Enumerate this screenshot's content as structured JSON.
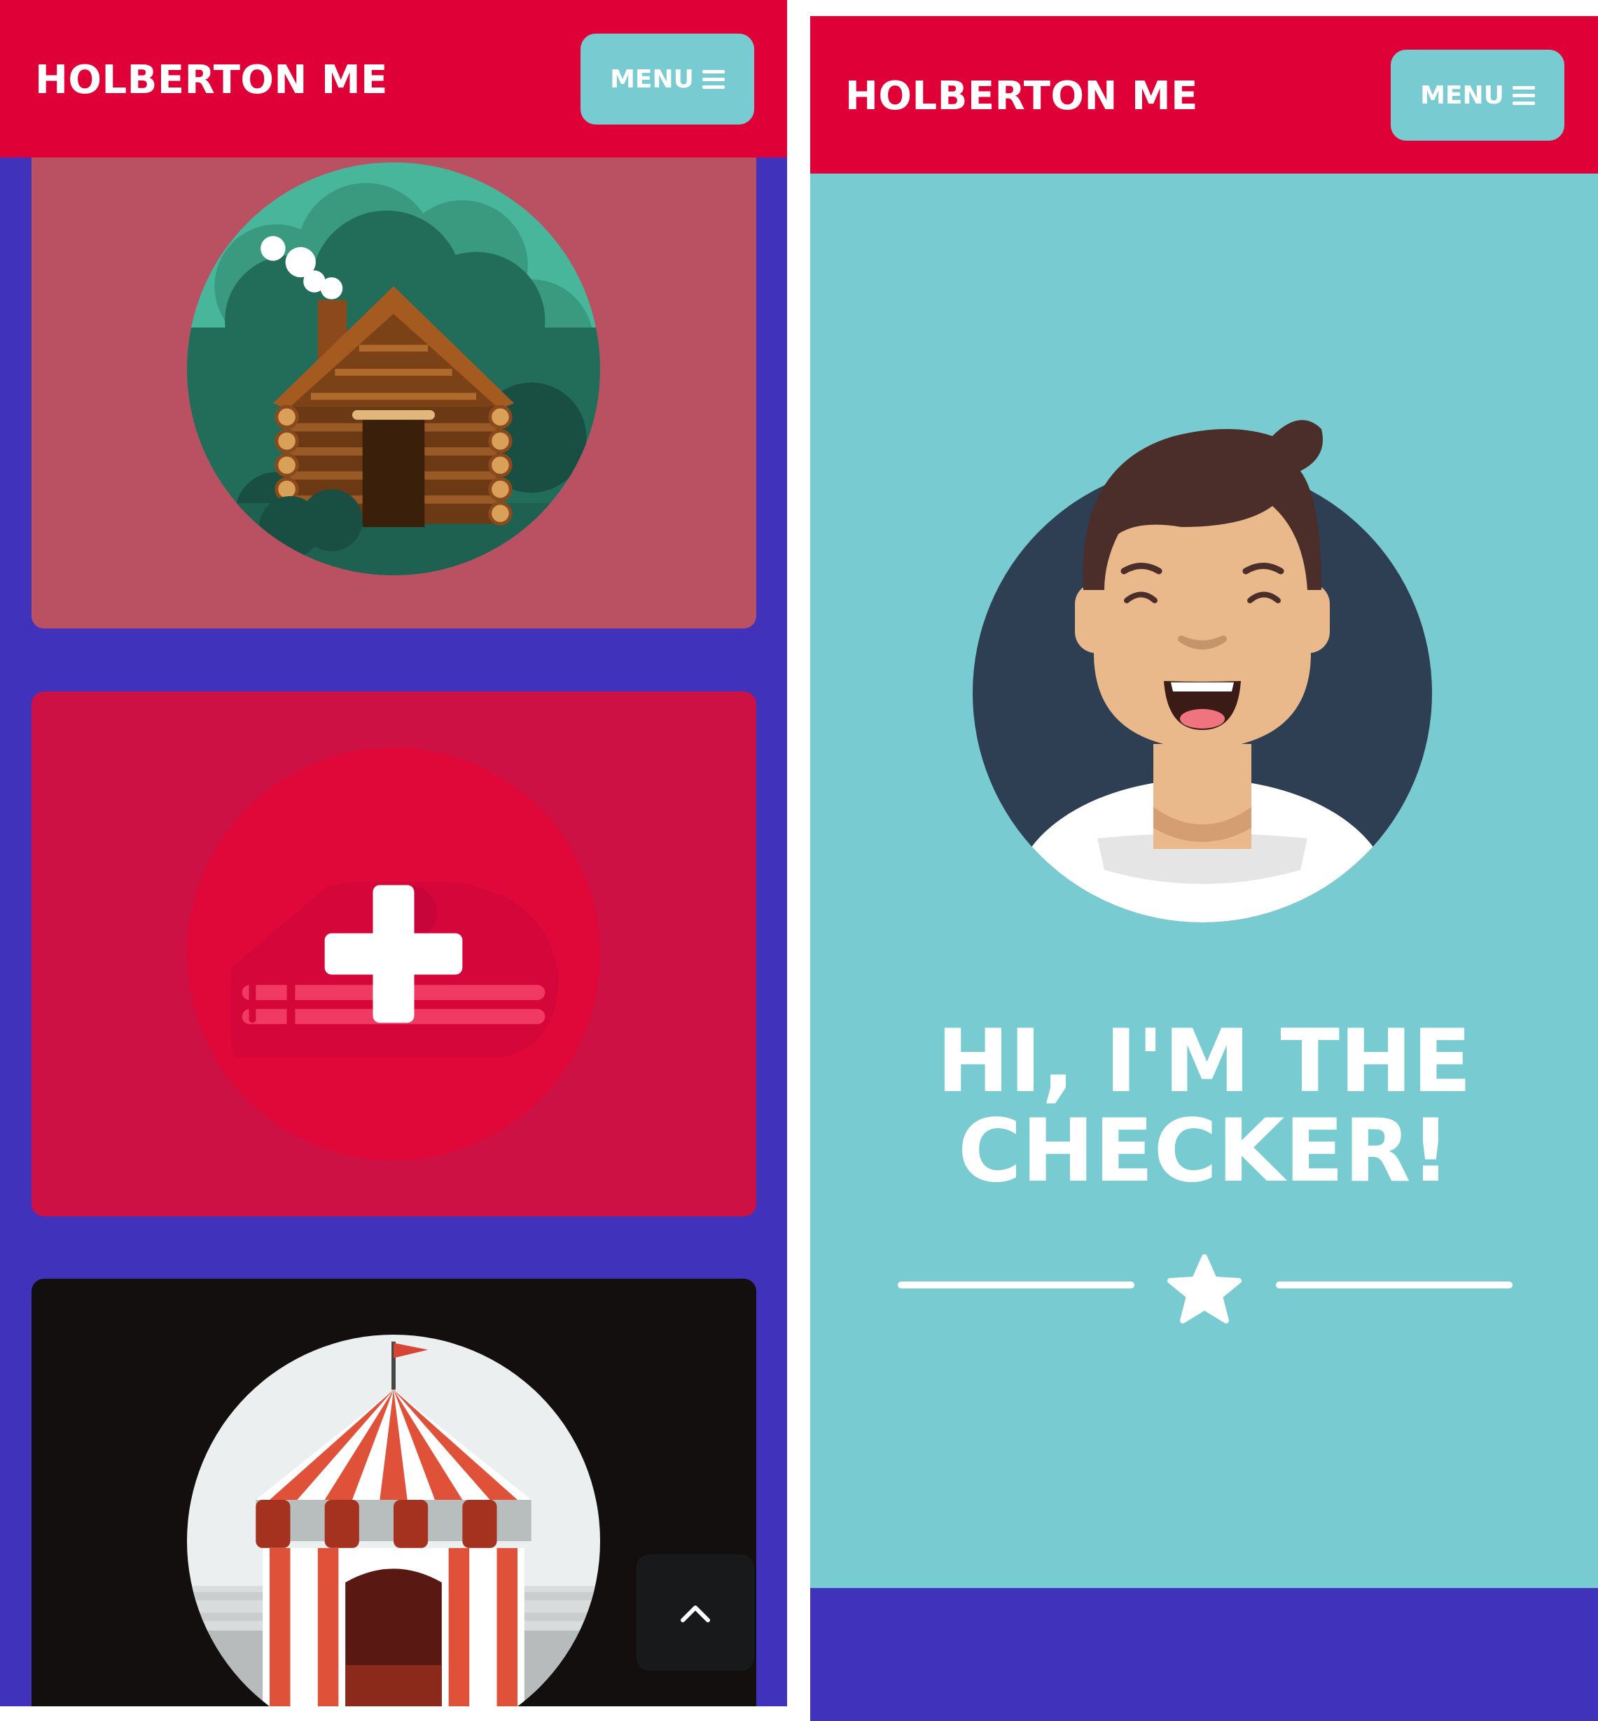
{
  "screens": [
    {
      "navbar": {
        "brand": "HOLBERTON ME",
        "menu_label": "MENU"
      },
      "cards": [
        {
          "icon": "log-cabin-icon",
          "background": "#b95163"
        },
        {
          "icon": "plus-icon",
          "background": "#cd1145"
        },
        {
          "icon": "circus-tent-icon",
          "background": "#130f0e"
        }
      ],
      "scroll_top_icon": "chevron-up-icon"
    },
    {
      "navbar": {
        "brand": "HOLBERTON ME",
        "menu_label": "MENU"
      },
      "hero": {
        "avatar_icon": "avatar-icon",
        "title_line1": "HI, I'M THE",
        "title_line2": "CHECKER!",
        "divider_icon": "star-icon"
      }
    }
  ],
  "colors": {
    "navbar": "#e00038",
    "menu_button": "#78cbd1",
    "page_background": "#4132bc",
    "hero_background": "#78cbd1",
    "text": "#ffffff"
  }
}
